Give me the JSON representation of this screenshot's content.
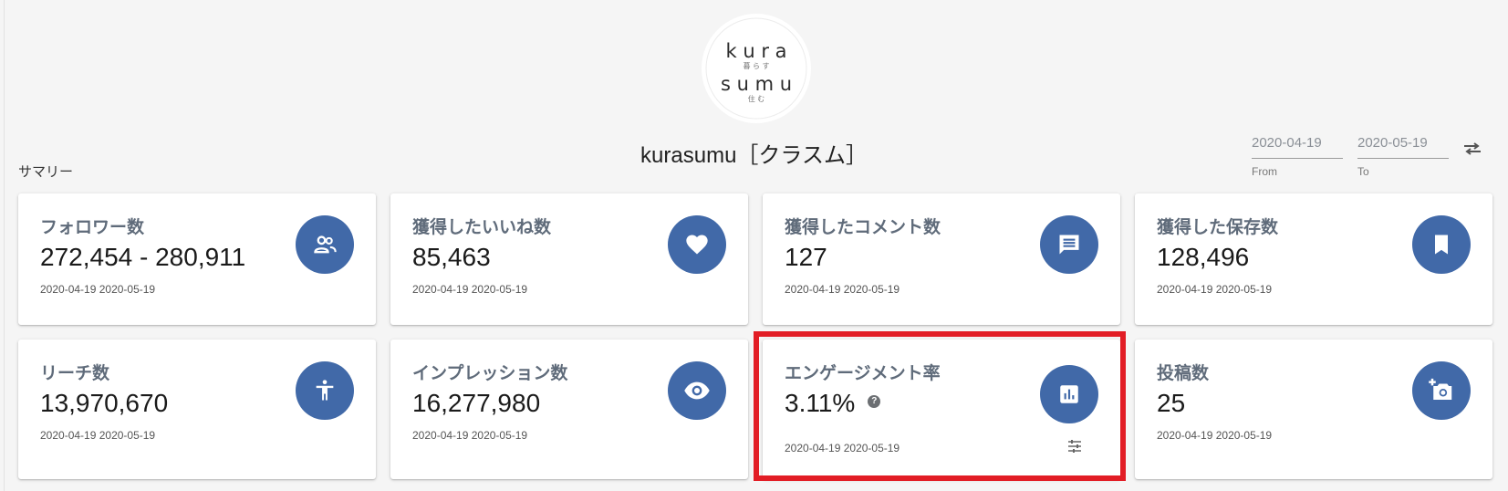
{
  "header": {
    "logo": {
      "line1": "k u r a",
      "line1_sub": "暮 ら す",
      "line2": "s u m u",
      "line2_sub": "住 む"
    },
    "title": "kurasumu［クラスム］",
    "summary_label": "サマリー"
  },
  "date_range": {
    "from_value": "2020-04-19",
    "from_label": "From",
    "to_value": "2020-05-19",
    "to_label": "To",
    "swap_icon": "swap-arrows-icon"
  },
  "cards": [
    {
      "label": "フォロワー数",
      "value": "272,454 - 280,911",
      "dates": "2020-04-19 2020-05-19",
      "icon": "people-icon"
    },
    {
      "label": "獲得したいいね数",
      "value": "85,463",
      "dates": "2020-04-19 2020-05-19",
      "icon": "heart-icon"
    },
    {
      "label": "獲得したコメント数",
      "value": "127",
      "dates": "2020-04-19 2020-05-19",
      "icon": "comment-icon"
    },
    {
      "label": "獲得した保存数",
      "value": "128,496",
      "dates": "2020-04-19 2020-05-19",
      "icon": "bookmark-icon"
    },
    {
      "label": "リーチ数",
      "value": "13,970,670",
      "dates": "2020-04-19 2020-05-19",
      "icon": "accessibility-icon"
    },
    {
      "label": "インプレッション数",
      "value": "16,277,980",
      "dates": "2020-04-19 2020-05-19",
      "icon": "eye-icon"
    },
    {
      "label": "エンゲージメント率",
      "value": "3.11%",
      "dates": "2020-04-19 2020-05-19",
      "icon": "bar-chart-icon",
      "help_glyph": "?"
    },
    {
      "label": "投稿数",
      "value": "25",
      "dates": "2020-04-19 2020-05-19",
      "icon": "add-photo-icon"
    }
  ],
  "colors": {
    "accent": "#4169a8",
    "highlight": "#e21d25",
    "label": "#5f6b7a",
    "background": "#f5f5f5"
  }
}
